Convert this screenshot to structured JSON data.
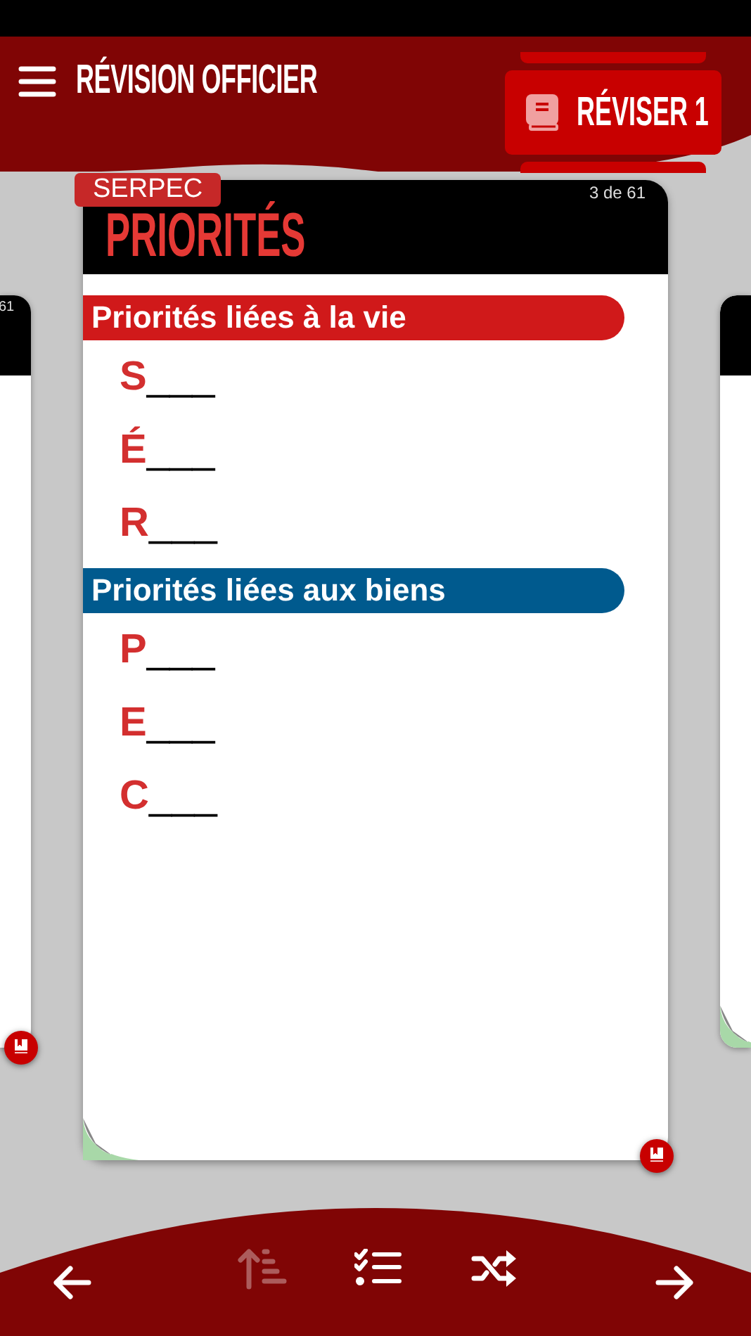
{
  "header": {
    "title": "RÉVISION OFFICIER",
    "review_button": "RÉVISER 1"
  },
  "previous_card": {
    "counter": "61"
  },
  "card": {
    "tag": "SERPEC",
    "title": "PRIORITÉS",
    "counter": "3 de 61",
    "sections": [
      {
        "heading": "Priorités liées à la vie",
        "color": "#d0191a",
        "items": [
          {
            "letter": "S",
            "blank": "___"
          },
          {
            "letter": "É",
            "blank": "___"
          },
          {
            "letter": "R",
            "blank": "___"
          }
        ]
      },
      {
        "heading": "Priorités liées aux biens",
        "color": "#005a8e",
        "items": [
          {
            "letter": "P",
            "blank": "___"
          },
          {
            "letter": "E",
            "blank": "___"
          },
          {
            "letter": "C",
            "blank": "___"
          }
        ]
      }
    ]
  },
  "toolbar": [
    {
      "kind": "back",
      "disabled": false
    },
    {
      "kind": "sort",
      "disabled": true
    },
    {
      "kind": "checklist",
      "disabled": false
    },
    {
      "kind": "shuffle",
      "disabled": false
    },
    {
      "kind": "forward",
      "disabled": false
    }
  ]
}
